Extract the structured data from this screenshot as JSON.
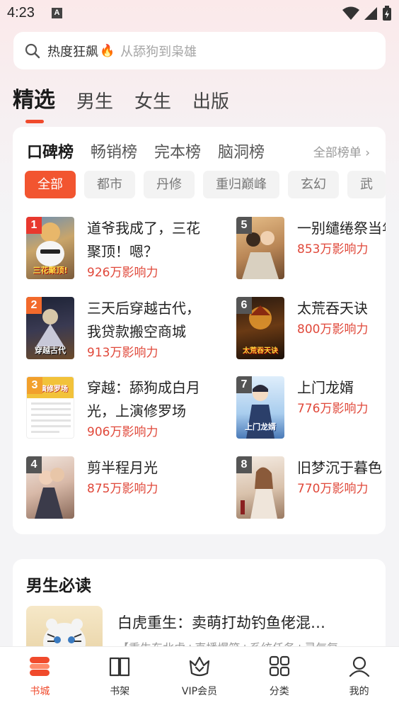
{
  "status": {
    "time": "4:23",
    "a_icon": "A"
  },
  "search": {
    "hot_label": "热度狂飙",
    "flame": "🔥",
    "hint": "从舔狗到枭雄"
  },
  "top_tabs": [
    {
      "label": "精选",
      "active": true
    },
    {
      "label": "男生",
      "active": false
    },
    {
      "label": "女生",
      "active": false
    },
    {
      "label": "出版",
      "active": false
    }
  ],
  "rank": {
    "tabs": [
      {
        "label": "口碑榜",
        "active": true
      },
      {
        "label": "畅销榜",
        "active": false
      },
      {
        "label": "完本榜",
        "active": false
      },
      {
        "label": "脑洞榜",
        "active": false
      }
    ],
    "all_label": "全部榜单 ›",
    "filters": [
      {
        "label": "全部",
        "active": true
      },
      {
        "label": "都市",
        "active": false
      },
      {
        "label": "丹修",
        "active": false
      },
      {
        "label": "重归巅峰",
        "active": false
      },
      {
        "label": "玄幻",
        "active": false
      },
      {
        "label": "武",
        "active": false
      }
    ],
    "books": [
      {
        "rank": "1",
        "title": "道爷我成了，三花聚顶！嗯？",
        "heat": "926万影响力",
        "cover_text": "三花聚顶!",
        "badge_color": "#e8382e"
      },
      {
        "rank": "2",
        "title": "三天后穿越古代，我贷款搬空商城",
        "heat": "913万影响力",
        "cover_text": "穿越古代",
        "badge_color": "#f26a2c"
      },
      {
        "rank": "3",
        "title": "穿越：舔狗成白月光，上演修罗场",
        "heat": "906万影响力",
        "cover_text": "上演修罗场",
        "badge_color": "#f2a02c"
      },
      {
        "rank": "4",
        "title": "剪半程月光",
        "heat": "875万影响力",
        "cover_text": "",
        "badge_color": "#555555"
      },
      {
        "rank": "5",
        "title": "一别缱绻祭当年",
        "heat": "853万影响力",
        "cover_text": "",
        "badge_color": "#555555"
      },
      {
        "rank": "6",
        "title": "太荒吞天诀",
        "heat": "800万影响力",
        "cover_text": "太荒吞天诀",
        "badge_color": "#555555"
      },
      {
        "rank": "7",
        "title": "上门龙婿",
        "heat": "776万影响力",
        "cover_text": "上门龙婿",
        "badge_color": "#555555"
      },
      {
        "rank": "8",
        "title": "旧梦沉于暮色",
        "heat": "770万影响力",
        "cover_text": "",
        "badge_color": "#555555"
      }
    ]
  },
  "boys_section": {
    "title": "男生必读",
    "book_title": "白虎重生：卖萌打劫钓鱼佬混…",
    "book_desc": "【重生东北虎+直播爆笑+系统任务+灵气复"
  },
  "bottom_nav": [
    {
      "label": "书城",
      "icon": "bookstore-icon",
      "active": true
    },
    {
      "label": "书架",
      "icon": "bookshelf-icon",
      "active": false
    },
    {
      "label": "VIP会员",
      "icon": "vip-crown-icon",
      "active": false
    },
    {
      "label": "分类",
      "icon": "category-grid-icon",
      "active": false
    },
    {
      "label": "我的",
      "icon": "profile-icon",
      "active": false
    }
  ],
  "colors": {
    "accent": "#f04a2c",
    "heat": "#e0483a"
  }
}
